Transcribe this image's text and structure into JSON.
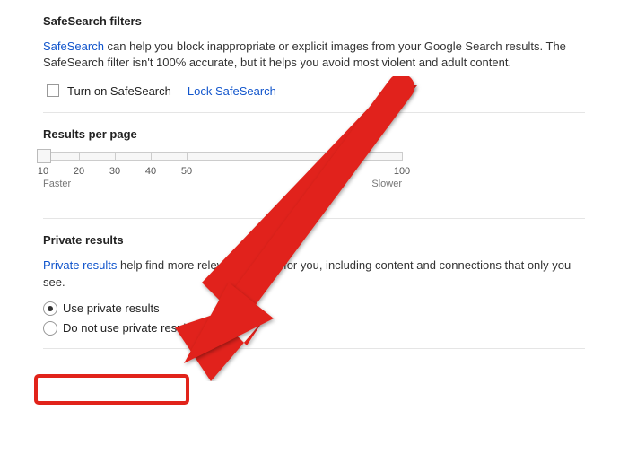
{
  "safesearch": {
    "heading": "SafeSearch filters",
    "link": "SafeSearch",
    "desc_rest": " can help you block inappropriate or explicit images from your Google Search results. The SafeSearch filter isn't 100% accurate, but it helps you avoid most violent and adult content.",
    "checkbox_label": "Turn on SafeSearch",
    "lock_link": "Lock SafeSearch"
  },
  "results_per_page": {
    "heading": "Results per page",
    "ticks": [
      "10",
      "20",
      "30",
      "40",
      "50",
      "100"
    ],
    "faster": "Faster",
    "slower": "Slower",
    "selected_value": "10"
  },
  "private_results": {
    "heading": "Private results",
    "link": "Private results",
    "desc_rest": " help find more relevant content for you, including content and connections that only you see.",
    "opt_use": "Use private results",
    "opt_dont": "Do not use private results",
    "selected": "use"
  }
}
